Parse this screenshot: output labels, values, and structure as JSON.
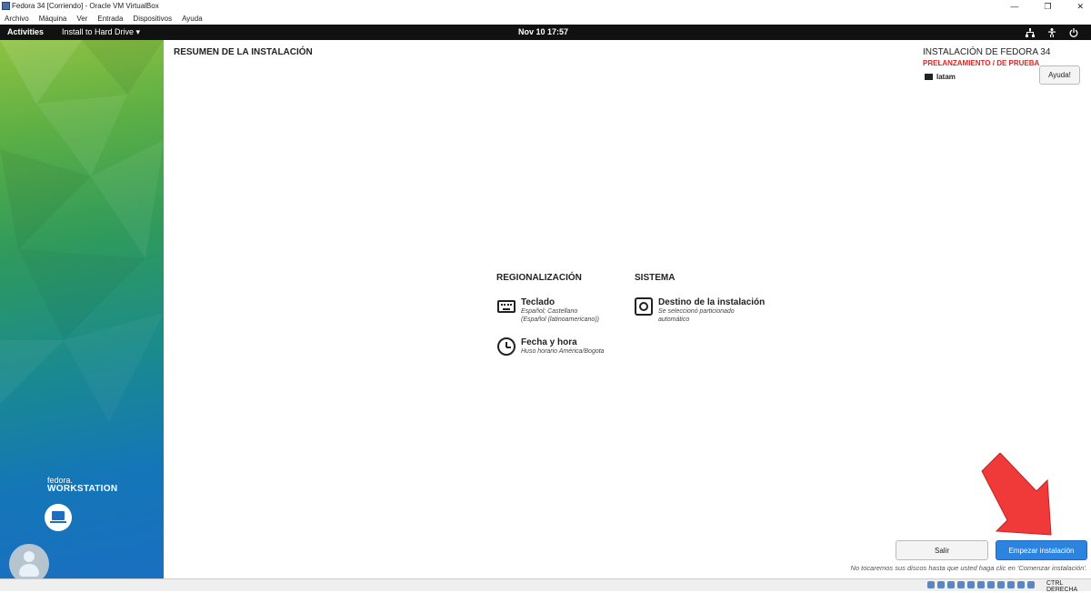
{
  "vbox": {
    "title": "Fedora 34 [Corriendo] - Oracle VM VirtualBox",
    "menu": [
      "Archivo",
      "Máquina",
      "Ver",
      "Entrada",
      "Dispositivos",
      "Ayuda"
    ],
    "window_buttons": [
      "—",
      "❐",
      "✕"
    ],
    "host_key": "CTRL DERECHA"
  },
  "topbar": {
    "activities": "Activities",
    "app_menu": "Install to Hard Drive ▾",
    "clock": "Nov 10  17:57",
    "tray_icons": [
      "network-icon",
      "accessibility-icon",
      "power-icon"
    ]
  },
  "sidebar": {
    "brand_line1": "fedora.",
    "brand_line2": "WORKSTATION"
  },
  "header": {
    "page_title": "RESUMEN DE LA INSTALACIÓN",
    "install_title": "INSTALACIÓN DE FEDORA 34",
    "prerelease": "PRELANZAMIENTO / DE PRUEBA",
    "keyboard_layout": "latam",
    "help_label": "Ayuda!"
  },
  "sections": {
    "localization": {
      "title": "REGIONALIZACIÓN",
      "keyboard": {
        "title": "Teclado",
        "status_line1": "Español; Castellano",
        "status_line2": "(Español (latinoamericano))"
      },
      "datetime": {
        "title": "Fecha y hora",
        "status_line1": "Huso horario América/Bogota"
      }
    },
    "system": {
      "title": "SISTEMA",
      "destination": {
        "title": "Destino de la instalación",
        "status_line1": "Se seleccionó particionado",
        "status_line2": "automático"
      }
    }
  },
  "footer": {
    "quit_label": "Salir",
    "begin_label": "Empezar instalación",
    "note": "No tocaremos sus discos hasta que usted haga clic en 'Comenzar instalación'."
  },
  "colors": {
    "primary_button": "#2c84e0",
    "prerelease_red": "#e22222",
    "arrow_red": "#f03a3a"
  }
}
